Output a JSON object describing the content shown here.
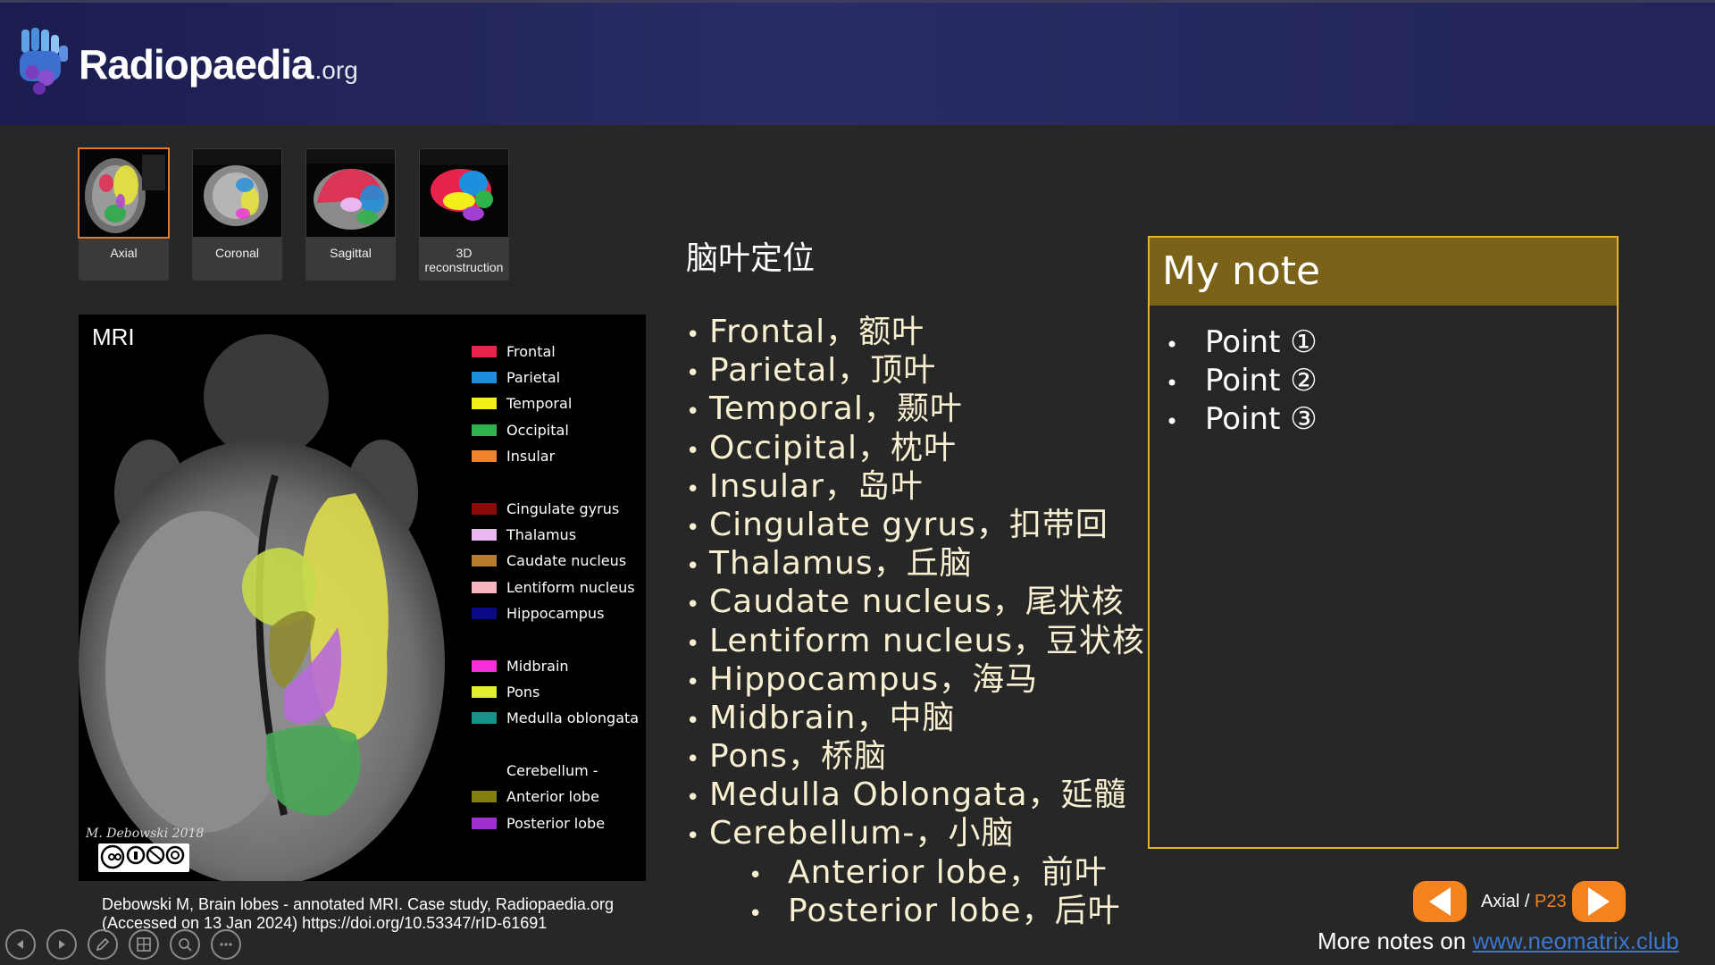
{
  "header": {
    "brand": "Radiopaedia",
    "brand_suffix": ".org"
  },
  "thumbnails": [
    {
      "caption": "Axial",
      "active": true
    },
    {
      "caption": "Coronal",
      "active": false
    },
    {
      "caption": "Sagittal",
      "active": false
    },
    {
      "caption": "3D reconstruction",
      "active": false
    }
  ],
  "mri": {
    "label": "MRI",
    "legend": [
      {
        "name": "Frontal",
        "color": "#e8244d"
      },
      {
        "name": "Parietal",
        "color": "#1e8fdd"
      },
      {
        "name": "Temporal",
        "color": "#f2ef1a"
      },
      {
        "name": "Occipital",
        "color": "#2fb34a"
      },
      {
        "name": "Insular",
        "color": "#f2822c"
      },
      {
        "name": "Cingulate gyrus",
        "color": "#8b0a0a"
      },
      {
        "name": "Thalamus",
        "color": "#e9b7ef"
      },
      {
        "name": "Caudate nucleus",
        "color": "#b87a2c"
      },
      {
        "name": "Lentiform nucleus",
        "color": "#f7b6bf"
      },
      {
        "name": "Hippocampus",
        "color": "#0a0a86"
      },
      {
        "name": "Midbrain",
        "color": "#f031d8"
      },
      {
        "name": "Pons",
        "color": "#dfef2a"
      },
      {
        "name": "Medulla oblongata",
        "color": "#17938a"
      },
      {
        "name": "Cerebellum -",
        "color": ""
      },
      {
        "name": "Anterior lobe",
        "color": "#848010"
      },
      {
        "name": "Posterior lobe",
        "color": "#9f2fcf"
      }
    ],
    "signature": "M. Debowski 2018"
  },
  "citation": {
    "line1": "Debowski M, Brain lobes - annotated MRI. Case study, Radiopaedia.org",
    "line2": "(Accessed on 13 Jan 2024) https://doi.org/10.53347/rID-61691"
  },
  "lobe_list": {
    "title": "脑叶定位",
    "items": [
      {
        "text": "Frontal，额叶",
        "sub": false
      },
      {
        "text": "Parietal，顶叶",
        "sub": false
      },
      {
        "text": "Temporal，颞叶",
        "sub": false
      },
      {
        "text": "Occipital，枕叶",
        "sub": false
      },
      {
        "text": "Insular，岛叶",
        "sub": false
      },
      {
        "text": "Cingulate gyrus，扣带回",
        "sub": false
      },
      {
        "text": "Thalamus，丘脑",
        "sub": false
      },
      {
        "text": "Caudate nucleus，尾状核",
        "sub": false
      },
      {
        "text": "Lentiform nucleus，豆状核",
        "sub": false
      },
      {
        "text": "Hippocampus，海马",
        "sub": false
      },
      {
        "text": "Midbrain，中脑",
        "sub": false
      },
      {
        "text": "Pons，桥脑",
        "sub": false
      },
      {
        "text": "Medulla Oblongata，延髓",
        "sub": false
      },
      {
        "text": "Cerebellum-，小脑",
        "sub": false
      },
      {
        "text": "Anterior lobe，前叶",
        "sub": true
      },
      {
        "text": "Posterior lobe，后叶",
        "sub": true
      }
    ]
  },
  "note": {
    "title": "My note",
    "points": [
      "Point ①",
      "Point ②",
      "Point ③"
    ]
  },
  "nav": {
    "view": "Axial",
    "separator": " / ",
    "page": "P23"
  },
  "footer": {
    "more_text": "More notes on ",
    "link_text": "www.neomatrix.club"
  },
  "colors": {
    "accent": "#f3821f",
    "note_border": "#e0b328",
    "note_header": "#7a6219",
    "header_bg": "#22245a"
  }
}
